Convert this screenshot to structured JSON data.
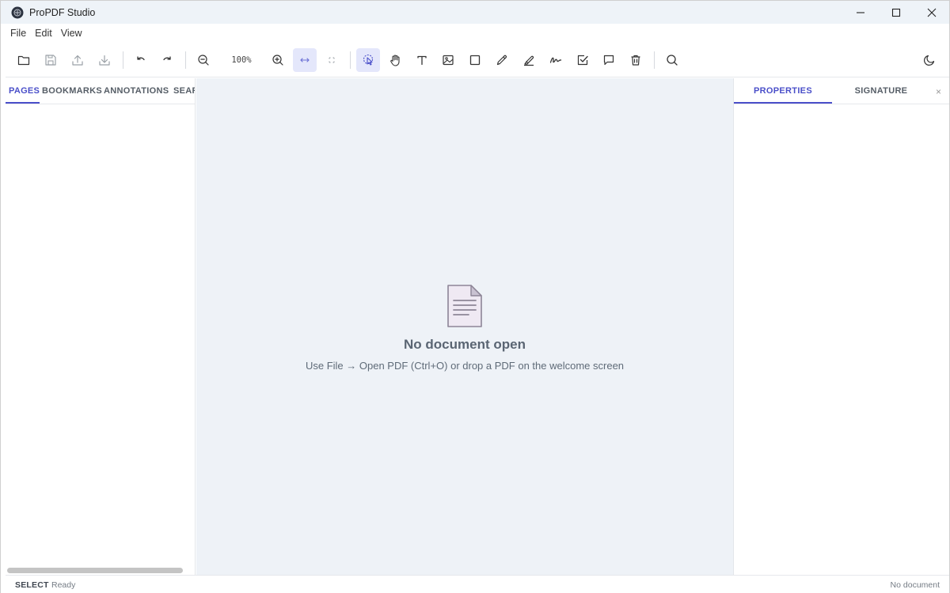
{
  "window": {
    "title": "ProPDF Studio",
    "icon": "app-logo-icon",
    "controls": [
      "minimize-icon",
      "maximize-icon",
      "close-icon"
    ]
  },
  "menu": {
    "items": [
      "File",
      "Edit",
      "View"
    ]
  },
  "toolbar": {
    "zoom_level": "100%",
    "buttons": [
      {
        "name": "open-folder-icon"
      },
      {
        "name": "save-icon"
      },
      {
        "name": "upload-icon"
      },
      {
        "name": "download-icon"
      },
      {
        "name": "undo-icon"
      },
      {
        "name": "redo-icon"
      },
      {
        "name": "zoom-out-icon"
      },
      {
        "name": "zoom-in-icon"
      },
      {
        "name": "fit-width-icon",
        "active": true
      },
      {
        "name": "fit-page-icon"
      },
      {
        "name": "select-tool-icon",
        "active": true
      },
      {
        "name": "hand-tool-icon"
      },
      {
        "name": "text-tool-icon"
      },
      {
        "name": "image-tool-icon"
      },
      {
        "name": "rectangle-tool-icon"
      },
      {
        "name": "pen-tool-icon"
      },
      {
        "name": "highlighter-tool-icon"
      },
      {
        "name": "signature-tool-icon"
      },
      {
        "name": "checkbox-tool-icon"
      },
      {
        "name": "comment-tool-icon"
      },
      {
        "name": "delete-icon"
      },
      {
        "name": "search-icon"
      },
      {
        "name": "theme-toggle-icon"
      }
    ]
  },
  "left_panel": {
    "tabs": [
      "PAGES",
      "BOOKMARKS",
      "ANNOTATIONS",
      "SEARCH"
    ],
    "active_tab": "PAGES"
  },
  "viewer": {
    "empty_icon": "document-icon",
    "empty_title": "No document open",
    "empty_subtitle": "Use File → Open PDF (Ctrl+O) or drop a PDF on the welcome screen"
  },
  "right_panel": {
    "tabs": [
      "PROPERTIES",
      "SIGNATURE"
    ],
    "active_tab": "PROPERTIES",
    "close_label": "×"
  },
  "status_bar": {
    "mode": "SELECT",
    "status": "Ready",
    "document": "No document"
  },
  "colors": {
    "accent": "#4a4fc9",
    "active_bg": "#e4e7fb",
    "viewer_bg": "#eef2f7",
    "titlebar_bg": "#eef3f8"
  }
}
